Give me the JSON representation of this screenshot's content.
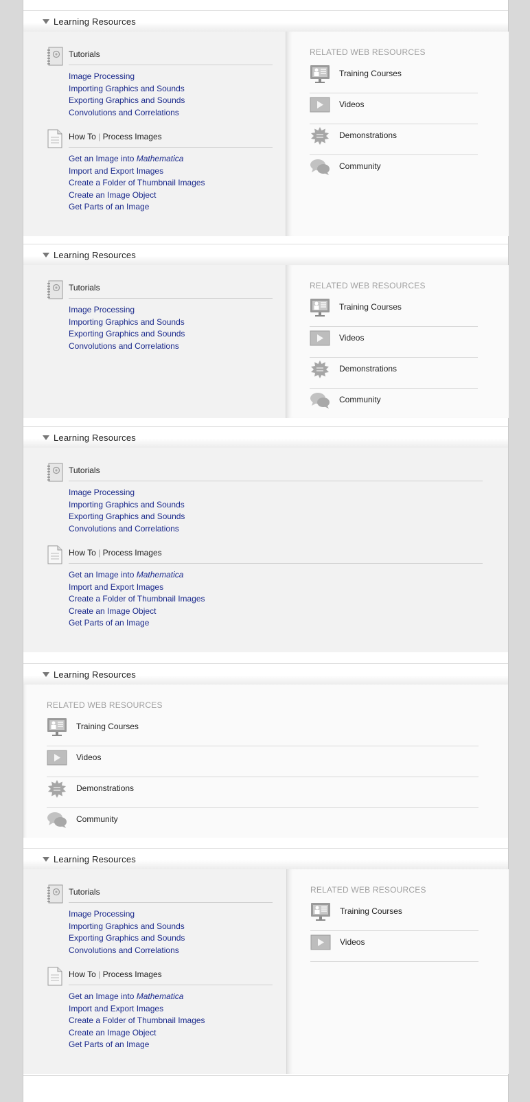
{
  "sections": [
    {
      "title": "Learning Resources",
      "tutorials": {
        "heading": "Tutorials",
        "links": [
          "Image Processing",
          "Importing Graphics and Sounds",
          "Exporting Graphics and Sounds",
          "Convolutions and Correlations"
        ]
      },
      "howto": {
        "heading_prefix": "How To",
        "separator": "|",
        "heading_topic": "Process Images",
        "links": [
          "Get an Image into ",
          "Import and Export Images",
          "Create a Folder of Thumbnail Images",
          "Create an Image Object",
          "Get Parts of an Image"
        ],
        "link0_italic": "Mathematica"
      },
      "related": {
        "title": "RELATED WEB RESOURCES",
        "items": [
          "Training Courses",
          "Videos",
          "Demonstrations",
          "Community"
        ]
      }
    },
    {
      "title": "Learning Resources",
      "tutorials": {
        "heading": "Tutorials",
        "links": [
          "Image Processing",
          "Importing Graphics and Sounds",
          "Exporting Graphics and Sounds",
          "Convolutions and Correlations"
        ]
      },
      "related": {
        "title": "RELATED WEB RESOURCES",
        "items": [
          "Training Courses",
          "Videos",
          "Demonstrations",
          "Community"
        ]
      }
    },
    {
      "title": "Learning Resources",
      "tutorials": {
        "heading": "Tutorials",
        "links": [
          "Image Processing",
          "Importing Graphics and Sounds",
          "Exporting Graphics and Sounds",
          "Convolutions and Correlations"
        ]
      },
      "howto": {
        "heading_prefix": "How To",
        "separator": "|",
        "heading_topic": "Process Images",
        "links": [
          "Get an Image into ",
          "Import and Export Images",
          "Create a Folder of Thumbnail Images",
          "Create an Image Object",
          "Get Parts of an Image"
        ],
        "link0_italic": "Mathematica"
      }
    },
    {
      "title": "Learning Resources",
      "related": {
        "title": "RELATED WEB RESOURCES",
        "items": [
          "Training Courses",
          "Videos",
          "Demonstrations",
          "Community"
        ]
      }
    },
    {
      "title": "Learning Resources",
      "tutorials": {
        "heading": "Tutorials",
        "links": [
          "Image Processing",
          "Importing Graphics and Sounds",
          "Exporting Graphics and Sounds",
          "Convolutions and Correlations"
        ]
      },
      "howto": {
        "heading_prefix": "How To",
        "separator": "|",
        "heading_topic": "Process Images",
        "links": [
          "Get an Image into ",
          "Import and Export Images",
          "Create a Folder of Thumbnail Images",
          "Create an Image Object",
          "Get Parts of an Image"
        ],
        "link0_italic": "Mathematica"
      },
      "related": {
        "title": "RELATED WEB RESOURCES",
        "items": [
          "Training Courses",
          "Videos"
        ]
      }
    }
  ],
  "icons": {
    "tutorials": "notebook-icon",
    "howto": "document-icon",
    "related": [
      "training-courses-icon",
      "videos-icon",
      "demonstrations-icon",
      "community-icon"
    ]
  },
  "colors": {
    "link": "#1b2a8c",
    "panel_left": "#f2f2f2",
    "panel_right": "#fafafa",
    "related_title": "#a0a0a0"
  }
}
